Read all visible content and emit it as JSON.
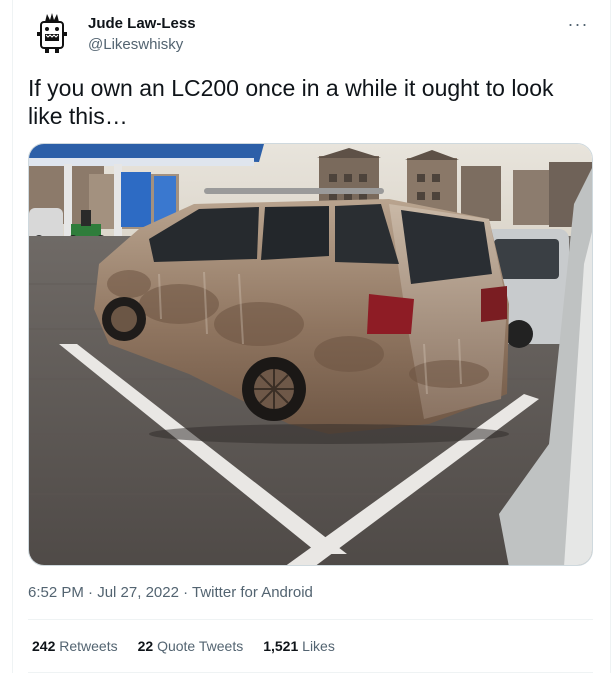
{
  "user": {
    "name": "Jude Law-Less",
    "handle": "@Likeswhisky"
  },
  "tweet": {
    "text": "If you own an LC200 once in a while it ought to look like this…"
  },
  "meta": {
    "time": "6:52 PM",
    "separator1": " · ",
    "date": "Jul 27, 2022",
    "separator2": " · ",
    "source": "Twitter for Android"
  },
  "stats": {
    "retweets_count": "242",
    "retweets_label": "Retweets",
    "quotes_count": "22",
    "quotes_label": "Quote Tweets",
    "likes_count": "1,521",
    "likes_label": "Likes"
  },
  "colors": {
    "text_primary": "#0f1419",
    "text_secondary": "#536471",
    "divider": "#eff3f4"
  },
  "icons": {
    "more": "more-horizontal-icon"
  }
}
